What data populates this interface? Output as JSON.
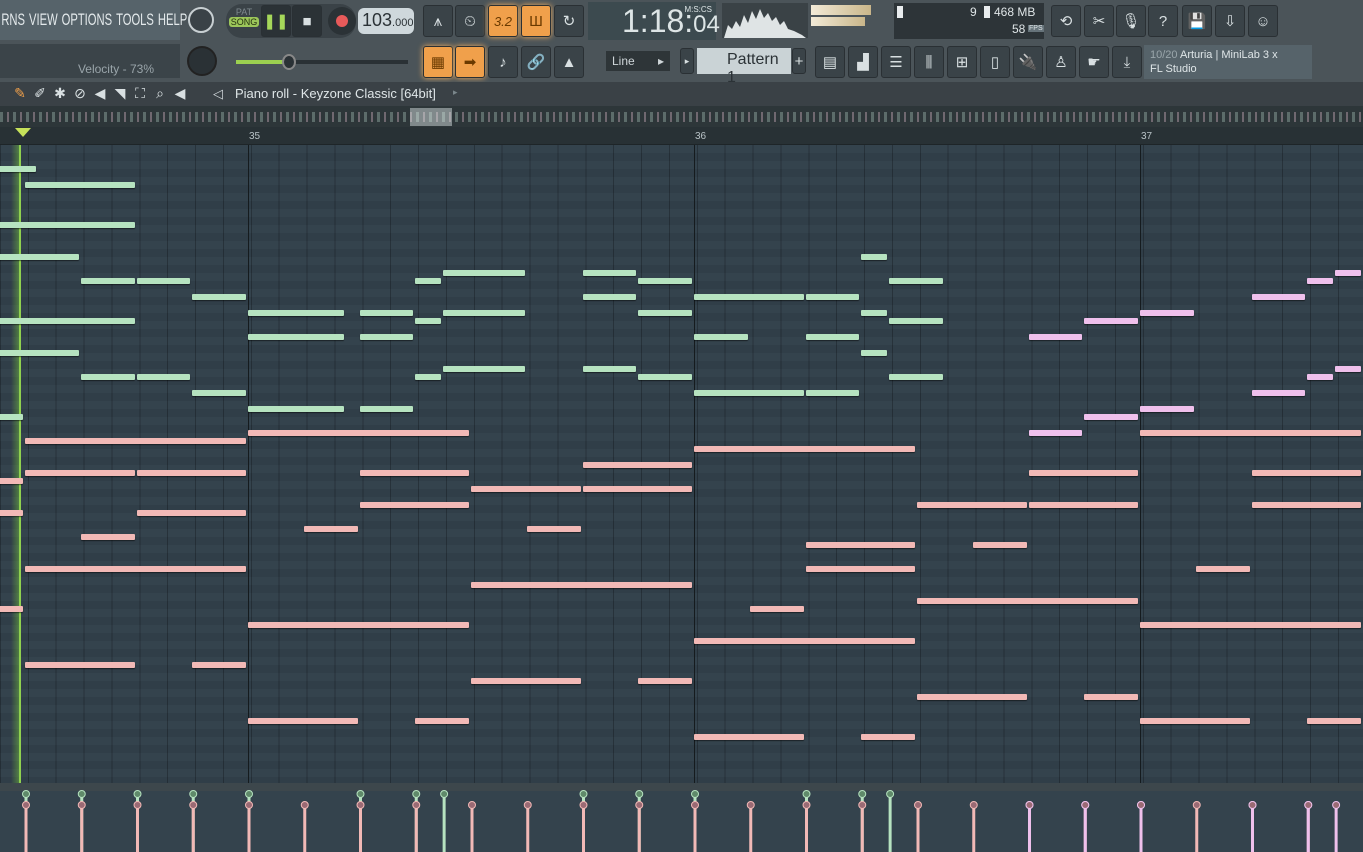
{
  "menu": {
    "items": [
      "RNS",
      "VIEW",
      "OPTIONS",
      "TOOLS",
      "HELP"
    ]
  },
  "hint": "Velocity - 73%",
  "transport": {
    "pat": "PAT",
    "song": "SONG",
    "tempo_int": "103",
    "tempo_dec": ".000"
  },
  "clock": {
    "main": "1:18:",
    "cs": "04",
    "label": "M:S:CS"
  },
  "cpu": {
    "voices": "9",
    "memory": "468 MB",
    "fps": "58",
    "fps_label": "FPS"
  },
  "snap": "Line",
  "pattern": "Pattern 1",
  "midi": {
    "line1_count": "10/20",
    "line1_name": "Arturia | MiniLab 3 x",
    "line2": "FL Studio"
  },
  "piano_roll": {
    "title": "Piano roll - Keyzone Classic [64bit]"
  },
  "ruler": {
    "bars": [
      "35",
      "36",
      "37"
    ]
  },
  "colors": {
    "green": "#b6e3c0",
    "pink": "#f2b9b6",
    "lavender": "#efc0ec",
    "accent": "#f0a04b",
    "playhead": "#8fd14f"
  },
  "playhead_bar": 34.49,
  "notes": {
    "green": [
      [
        34.375,
        34.53,
        2
      ],
      [
        34.5,
        34.75,
        4
      ],
      [
        34.375,
        34.75,
        9
      ],
      [
        34.375,
        34.625,
        13
      ],
      [
        36.375,
        36.4375,
        13
      ],
      [
        35.4375,
        35.625,
        15
      ],
      [
        35.75,
        35.875,
        15
      ],
      [
        34.625,
        34.75,
        16
      ],
      [
        34.75,
        34.875,
        16
      ],
      [
        35.375,
        35.4375,
        16
      ],
      [
        35.875,
        36,
        16
      ],
      [
        36.4375,
        36.5625,
        16
      ],
      [
        34.875,
        35,
        18
      ],
      [
        35.75,
        35.875,
        18
      ],
      [
        36,
        36.25,
        18
      ],
      [
        36.25,
        36.375,
        18
      ],
      [
        34.375,
        34.43,
        20
      ],
      [
        35,
        35.21875,
        20
      ],
      [
        35.25,
        35.375,
        20
      ],
      [
        35.4375,
        35.625,
        20
      ],
      [
        35.875,
        36,
        20
      ],
      [
        36.375,
        36.4375,
        20
      ],
      [
        34.375,
        34.75,
        21
      ],
      [
        35.375,
        35.4375,
        21
      ],
      [
        36.4375,
        36.5625,
        21
      ],
      [
        35,
        35.21875,
        23
      ],
      [
        35.25,
        35.375,
        23
      ],
      [
        36,
        36.125,
        23
      ],
      [
        36.25,
        36.375,
        23
      ],
      [
        34.375,
        34.625,
        25
      ],
      [
        36.375,
        36.4375,
        25
      ],
      [
        35.4375,
        35.625,
        27
      ],
      [
        35.75,
        35.875,
        27
      ],
      [
        34.625,
        34.75,
        28
      ],
      [
        34.75,
        34.875,
        28
      ],
      [
        35.375,
        35.4375,
        28
      ],
      [
        35.875,
        36,
        28
      ],
      [
        36.4375,
        36.5625,
        28
      ],
      [
        34.875,
        35,
        30
      ],
      [
        36,
        36.25,
        30
      ],
      [
        36.25,
        36.375,
        30
      ],
      [
        35,
        35.21875,
        32
      ],
      [
        35.25,
        35.375,
        32
      ],
      [
        34.375,
        34.5,
        33
      ]
    ],
    "pink": [
      [
        35,
        35.5,
        35
      ],
      [
        37,
        37.5,
        35
      ],
      [
        34.5,
        35,
        36
      ],
      [
        36,
        36.5,
        37
      ],
      [
        35.75,
        36,
        39
      ],
      [
        34.5,
        34.75,
        40
      ],
      [
        34.75,
        35,
        40
      ],
      [
        35.25,
        35.5,
        40
      ],
      [
        36.75,
        37,
        40
      ],
      [
        37.25,
        37.5,
        40
      ],
      [
        34.375,
        34.5,
        41
      ],
      [
        35.5,
        35.75,
        42
      ],
      [
        35.75,
        36,
        42
      ],
      [
        35.25,
        35.5,
        44
      ],
      [
        36.5,
        36.75,
        44
      ],
      [
        36.75,
        37,
        44
      ],
      [
        37.25,
        37.5,
        44
      ],
      [
        34.375,
        34.5,
        45
      ],
      [
        34.75,
        35,
        45
      ],
      [
        35.125,
        35.25,
        47
      ],
      [
        35.625,
        35.75,
        47
      ],
      [
        34.625,
        34.75,
        48
      ],
      [
        36.25,
        36.5,
        49
      ],
      [
        36.625,
        36.75,
        49
      ],
      [
        34.5,
        35,
        52
      ],
      [
        36.25,
        36.5,
        52
      ],
      [
        37.125,
        37.25,
        52
      ],
      [
        35.5,
        36,
        54
      ],
      [
        36.5,
        37,
        56
      ],
      [
        34.375,
        34.5,
        57
      ],
      [
        36.125,
        36.25,
        57
      ],
      [
        35,
        35.5,
        59
      ],
      [
        37,
        37.5,
        59
      ],
      [
        36,
        36.5,
        61
      ],
      [
        34.5,
        34.75,
        64
      ],
      [
        34.875,
        35,
        64
      ],
      [
        35.5,
        35.75,
        66
      ],
      [
        35.875,
        36,
        66
      ],
      [
        36.5,
        36.75,
        68
      ],
      [
        36.875,
        37,
        68
      ],
      [
        34.375,
        34.42,
        69
      ],
      [
        35,
        35.25,
        71
      ],
      [
        35.375,
        35.5,
        71
      ],
      [
        37,
        37.25,
        71
      ],
      [
        37.375,
        37.5,
        71
      ],
      [
        36,
        36.25,
        73
      ],
      [
        36.375,
        36.5,
        73
      ]
    ],
    "lavender": [
      [
        37.4375,
        37.5,
        15
      ],
      [
        37.375,
        37.4375,
        16
      ],
      [
        37.25,
        37.375,
        18
      ],
      [
        37,
        37.125,
        20
      ],
      [
        36.875,
        37,
        21
      ],
      [
        36.75,
        36.875,
        23
      ],
      [
        37.4375,
        37.5,
        27
      ],
      [
        37.375,
        37.4375,
        28
      ],
      [
        37.25,
        37.375,
        30
      ],
      [
        37,
        37.125,
        32
      ],
      [
        36.875,
        37,
        33
      ],
      [
        36.75,
        36.875,
        35
      ]
    ]
  }
}
